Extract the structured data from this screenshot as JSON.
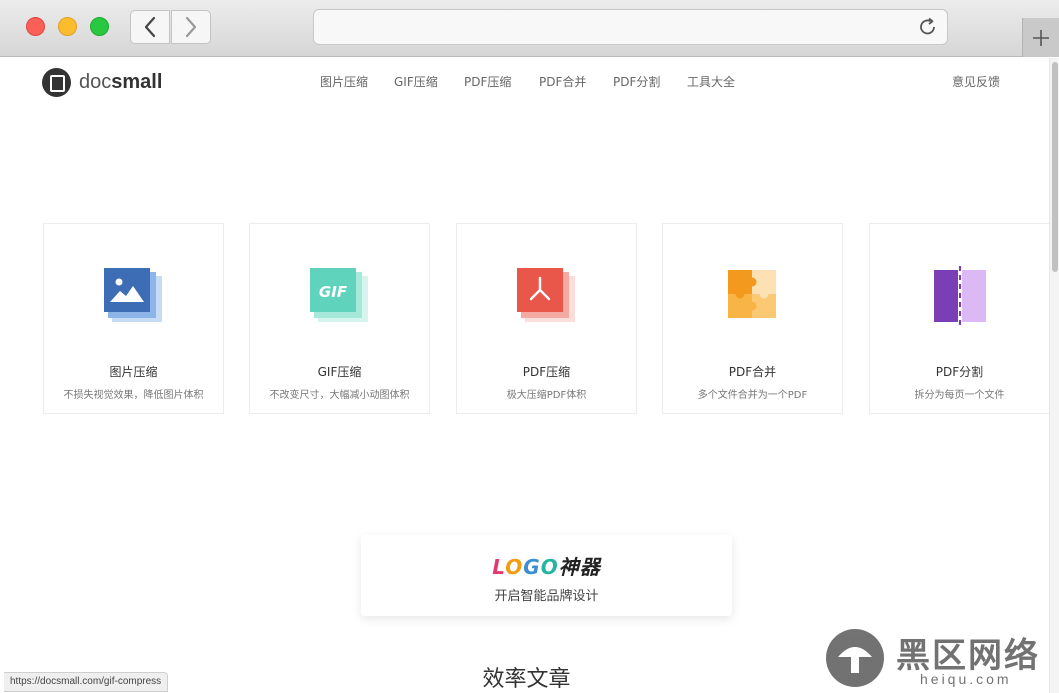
{
  "browser": {
    "url_value": "",
    "status_url": "https://docsmall.com/gif-compress"
  },
  "site": {
    "logo_prefix": "doc",
    "logo_suffix": "small"
  },
  "nav": {
    "items": [
      "图片压缩",
      "GIF压缩",
      "PDF压缩",
      "PDF合并",
      "PDF分割",
      "工具大全"
    ],
    "feedback": "意见反馈"
  },
  "tools": [
    {
      "title": "图片压缩",
      "desc": "不损失视觉效果，降低图片体积",
      "icon": "image-compress-icon"
    },
    {
      "title": "GIF压缩",
      "desc": "不改变尺寸，大幅减小动图体积",
      "icon": "gif-compress-icon"
    },
    {
      "title": "PDF压缩",
      "desc": "极大压缩PDF体积",
      "icon": "pdf-compress-icon"
    },
    {
      "title": "PDF合并",
      "desc": "多个文件合并为一个PDF",
      "icon": "pdf-merge-icon"
    },
    {
      "title": "PDF分割",
      "desc": "拆分为每页一个文件",
      "icon": "pdf-split-icon"
    }
  ],
  "promo": {
    "logo_letters": [
      "L",
      "O",
      "G",
      "O"
    ],
    "logo_cn": "神器",
    "subtitle": "开启智能品牌设计"
  },
  "section": {
    "title": "效率文章"
  },
  "watermark": {
    "text": "黑区网络",
    "sub": "heiqu.com"
  },
  "colors": {
    "image_icon": "#3d6db5",
    "gif_icon": "#5fd3bc",
    "pdf_icon": "#e8574a",
    "merge_icon": "#f5a02a",
    "split_icon": "#7b3fb5"
  }
}
